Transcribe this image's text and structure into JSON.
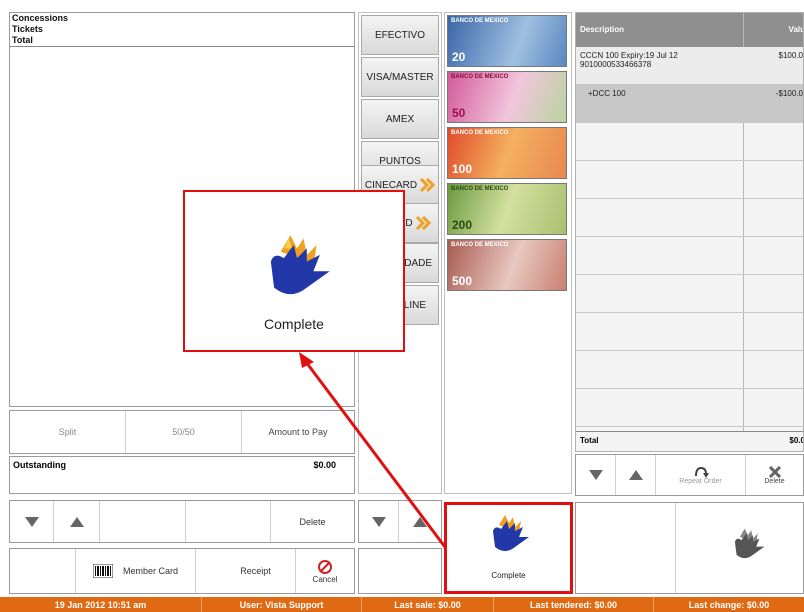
{
  "summary": {
    "concessions": "Concessions",
    "tickets": "Tickets",
    "total": "Total"
  },
  "split_bar": {
    "split": "Split",
    "fifty_fifty": "50/50",
    "amount_to_pay": "Amount to Pay"
  },
  "outstanding": {
    "label": "Outstanding",
    "value": "$0.00"
  },
  "nav": {
    "delete": "Delete"
  },
  "footer_bar": {
    "member_card": "Member Card",
    "receipt": "Receipt",
    "cancel": "Cancel"
  },
  "payments": [
    "EFECTIVO",
    "VISA/MASTER",
    "AMEX",
    "PUNTOS",
    "CINECARD",
    "VA CARD",
    "IDADE",
    "LINE"
  ],
  "banknotes": [
    {
      "label": "BANCO DE MEXICO",
      "value": "20"
    },
    {
      "label": "BANCO DE MEXICO",
      "value": "50"
    },
    {
      "label": "BANCO DE MEXICO",
      "value": "100"
    },
    {
      "label": "BANCO DE MEXICO",
      "value": "200"
    },
    {
      "label": "BANCO DE MEXICO",
      "value": "500"
    }
  ],
  "order_table": {
    "col_description": "Description",
    "col_value": "Valu",
    "rows": [
      {
        "line1": "CCCN 100 Expiry:19 Jul 12",
        "line2": "9010000533466378",
        "value": "$100.0"
      },
      {
        "line1": "+DCC 100",
        "line2": "",
        "value": "-$100.0"
      }
    ],
    "total_label": "Total",
    "total_value": "$0.0"
  },
  "order_actions": {
    "repeat_order": "Repeat Order",
    "delete": "Delete"
  },
  "complete": {
    "label": "Complete"
  },
  "callout": {
    "label": "Complete"
  },
  "status_bar": {
    "datetime": "19 Jan 2012 10:51 am",
    "user": "User: Vista Support",
    "last_sale": "Last sale: $0.00",
    "last_tendered": "Last tendered: $0.00",
    "last_change": "Last change: $0.00"
  },
  "colors": {
    "accent_red": "#e01010",
    "status_orange": "#e06a14",
    "table_header": "#8f8f8f",
    "selected_row": "#c8c8c8"
  }
}
